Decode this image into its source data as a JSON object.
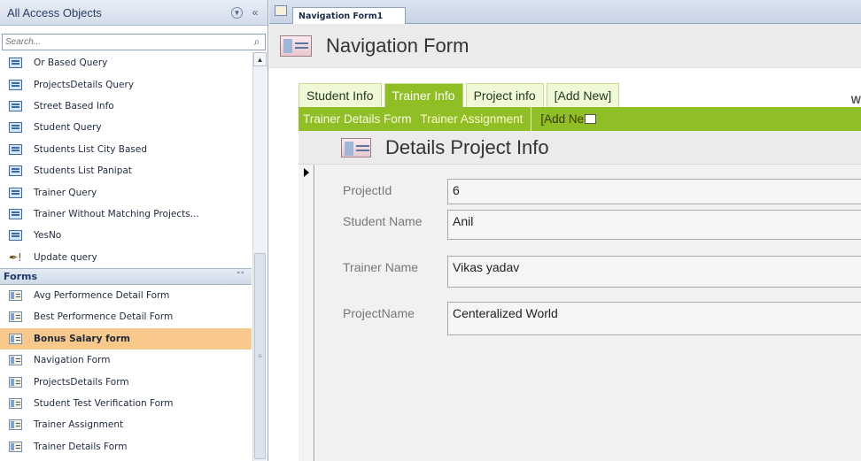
{
  "nav_pane": {
    "title": "All Access Objects",
    "search_placeholder": "Search...",
    "query_items": [
      "Or Based Query",
      "ProjectsDetails Query",
      "Street Based Info",
      "Student Query",
      "Students List City Based",
      "Students List Panipat",
      "Trainer Query",
      "Trainer Without Matching Projects...",
      "YesNo",
      "Update query"
    ],
    "forms_group": "Forms",
    "form_items": [
      "Avg Performence Detail Form",
      "Best Performence Detail Form",
      "Bonus Salary form",
      "Navigation Form",
      "ProjectsDetails Form",
      "Student Test Verification Form",
      "Trainer Assignment",
      "Trainer Details Form"
    ],
    "selected_item": "Bonus Salary form"
  },
  "doc_tab": {
    "label": "Navigation Form1"
  },
  "form": {
    "title": "Navigation Form",
    "top_tabs": [
      "Student Info",
      "Trainer Info",
      "Project info",
      "[Add New]"
    ],
    "active_top_tab": "Trainer Info",
    "sub_tabs": [
      "Trainer Details Form",
      "Trainer Assignment",
      "[Add Ne"
    ],
    "active_sub_tab": "Trainer Assignment",
    "partial_text": "W"
  },
  "subform": {
    "title": "Details Project Info",
    "fields": [
      {
        "label": "ProjectId",
        "value": "6"
      },
      {
        "label": "Student Name",
        "value": "Anil"
      },
      {
        "label": "Trainer Name",
        "value": "Vikas yadav"
      },
      {
        "label": "ProjectName",
        "value": "Centeralized World"
      }
    ]
  },
  "colors": {
    "nav_green": "#8fbe25",
    "selected_orange": "#f8c98a"
  }
}
